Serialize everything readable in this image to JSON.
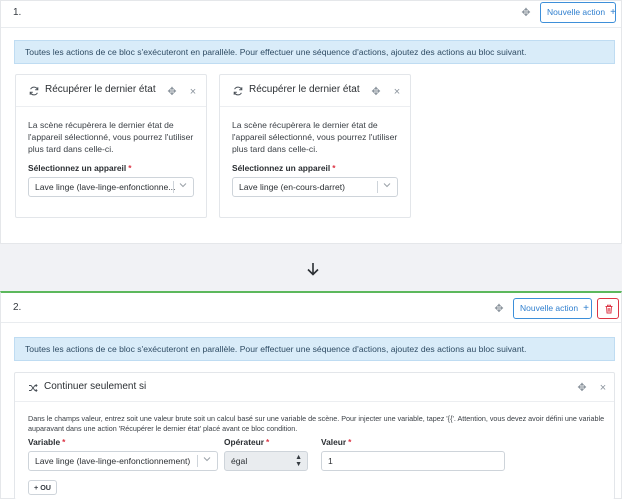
{
  "blocks": [
    {
      "number": "1.",
      "new_action_label": "Nouvelle action",
      "alert": "Toutes les actions de ce bloc s'exécuteront en parallèle. Pour effectuer une séquence d'actions, ajoutez des actions au bloc suivant.",
      "cards": [
        {
          "title": "Récupérer le dernier état",
          "description": "La scène récupèrera le dernier état de l'appareil sélectionné, vous pourrez l'utiliser plus tard dans celle-ci.",
          "device_label": "Sélectionnez un appareil",
          "device_value": "Lave linge (lave-linge-enfonctionne..."
        },
        {
          "title": "Récupérer le dernier état",
          "description": "La scène récupèrera le dernier état de l'appareil sélectionné, vous pourrez l'utiliser plus tard dans celle-ci.",
          "device_label": "Sélectionnez un appareil",
          "device_value": "Lave linge (en-cours-darret)"
        }
      ]
    },
    {
      "number": "2.",
      "new_action_label": "Nouvelle action",
      "alert": "Toutes les actions de ce bloc s'exécuteront en parallèle. Pour effectuer une séquence d'actions, ajoutez des actions au bloc suivant.",
      "condition": {
        "title": "Continuer seulement si",
        "description": "Dans le champs valeur, entrez soit une valeur brute soit un calcul basé sur une variable de scène. Pour injecter une variable, tapez '{{'. Attention, vous devez avoir défini une variable auparavant dans une action 'Récupérer le dernier état' placé avant ce bloc condition.",
        "variable_label": "Variable",
        "variable_value": "Lave linge (lave-linge-enfonctionnement)",
        "operator_label": "Opérateur",
        "operator_value": "égal",
        "value_label": "Valeur",
        "value_value": "1",
        "or_button": "+ OU"
      }
    }
  ],
  "required_mark": "*",
  "icons": {
    "move": "move-icon",
    "close": "close-icon",
    "plus": "plus-icon",
    "refresh": "refresh-icon",
    "shuffle": "shuffle-icon",
    "trash": "trash-icon",
    "arrow_down": "arrow-down-icon",
    "chevron": "chevron-down-icon"
  },
  "colors": {
    "primary": "#2f7fcf",
    "danger": "#dc3545",
    "success": "#5cb85c",
    "alert_bg": "#d9ecf9"
  }
}
